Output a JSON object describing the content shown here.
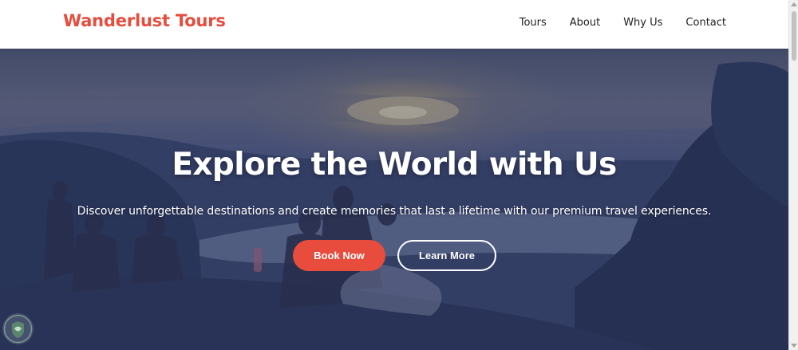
{
  "brand": {
    "name": "Wanderlust Tours"
  },
  "nav": {
    "items": [
      {
        "label": "Tours"
      },
      {
        "label": "About"
      },
      {
        "label": "Why Us"
      },
      {
        "label": "Contact"
      }
    ]
  },
  "hero": {
    "title": "Explore the World with Us",
    "subtitle": "Discover unforgettable destinations and create memories that last a lifetime with our premium travel experiences.",
    "primary_button": "Book Now",
    "secondary_button": "Learn More",
    "background_icon": "sunset-travelers-photo"
  },
  "colors": {
    "brand": "#e74c3c",
    "nav_text": "#222222",
    "hero_text": "#ffffff",
    "overlay": "#26325f"
  },
  "icons": {
    "badge": "shield-leaf-icon"
  }
}
